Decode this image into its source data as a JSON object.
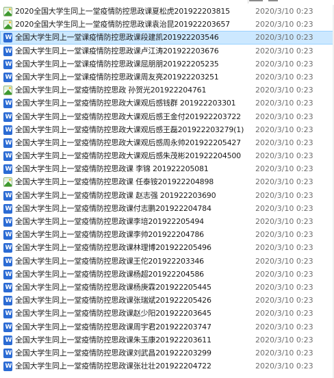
{
  "files": [
    {
      "name": "2020全国大学生同上一堂疫情防控思政课夏松虎201922203815",
      "date": "2020/3/10 0:23",
      "icon": "image-icon"
    },
    {
      "name": "2020全国大学生同上一堂疫情防控思政课袁治昆201922203657",
      "date": "2020/3/10 0:23",
      "icon": "image-icon"
    },
    {
      "name": "全国大学生同上一堂课疫情防控思政课段建凯201922203546",
      "date": "2020/3/10 0:23",
      "icon": "word-icon",
      "selected": true
    },
    {
      "name": "全国大学生同上一堂课疫情防控思政课卢江涛201922203676",
      "date": "2020/3/10 0:23",
      "icon": "word-icon"
    },
    {
      "name": "全国大学生同上一堂课疫情防控思政课屈朋朋201922205235",
      "date": "2020/3/10 0:23",
      "icon": "word-icon"
    },
    {
      "name": "全国大学生同上一堂课疫情防控思政课周友亮201922203251",
      "date": "2020/3/10 0:23",
      "icon": "word-icon"
    },
    {
      "name": "全国大学生同上一堂疫情防控思政 孙贺光201922204761",
      "date": "2020/3/10 0:23",
      "icon": "image-icon"
    },
    {
      "name": "全国大学生同上一堂疫情防控思政大课观后感钱群 201922203301",
      "date": "2020/3/10 0:23",
      "icon": "word-icon"
    },
    {
      "name": "全国大学生同上一堂疫情防控思政大课观后感王金付201922203722",
      "date": "2020/3/10 0:23",
      "icon": "word-icon"
    },
    {
      "name": "全国大学生同上一堂疫情防控思政大课观后感王磊201922203279(1)",
      "date": "2020/3/10 0:23",
      "icon": "word-icon"
    },
    {
      "name": "全国大学生同上一堂疫情防控思政大课观后感周永帅201922205427",
      "date": "2020/3/10 0:23",
      "icon": "word-icon"
    },
    {
      "name": "全国大学生同上一堂疫情防控思政大课观后感朱茂彬201922204500",
      "date": "2020/3/10 0:23",
      "icon": "word-icon"
    },
    {
      "name": "全国大学生同上一堂疫情防控思政课 李锦 201922205081",
      "date": "2020/3/10 0:23",
      "icon": "word-icon"
    },
    {
      "name": "全国大学生同上一堂疫情防控思政课 任泰铵201922204898",
      "date": "2020/3/10 0:23",
      "icon": "image-icon"
    },
    {
      "name": "全国大学生同上一堂疫情防控思政课 赵志强 201922203690",
      "date": "2020/3/10 0:23",
      "icon": "word-icon"
    },
    {
      "name": "全国大学生同上一堂疫情防控思政课付志鹏201922204784",
      "date": "2020/3/10 0:23",
      "icon": "word-icon"
    },
    {
      "name": "全国大学生同上一堂疫情防控思政课李培201922205494",
      "date": "2020/3/10 0:23",
      "icon": "word-icon"
    },
    {
      "name": "全国大学生同上一堂疫情防控思政课李帅201922204786",
      "date": "2020/3/10 0:23",
      "icon": "word-icon"
    },
    {
      "name": "全国大学生同上一堂疫情防控思政课林理博201922205496",
      "date": "2020/3/10 0:23",
      "icon": "word-icon"
    },
    {
      "name": "全国大学生同上一堂疫情防控思政课王佗201922203346",
      "date": "2020/3/10 0:23",
      "icon": "word-icon"
    },
    {
      "name": "全国大学生同上一堂疫情防控思政课杨超201922204586",
      "date": "2020/3/10 0:23",
      "icon": "word-icon"
    },
    {
      "name": "全国大学生同上一堂疫情防控思政课杨庚霖201922205445",
      "date": "2020/3/10 0:23",
      "icon": "word-icon"
    },
    {
      "name": "全国大学生同上一堂疫情防控思政课张瑞斌201922205426",
      "date": "2020/3/10 0:23",
      "icon": "word-icon"
    },
    {
      "name": "全国大学生同上一堂疫情防控思政课赵少阳201922203645",
      "date": "2020/3/10 0:23",
      "icon": "word-icon"
    },
    {
      "name": "全国大学生同上一堂疫情防控思政课周宇君201922203747",
      "date": "2020/3/10 0:23",
      "icon": "word-icon"
    },
    {
      "name": "全国大学生同上一堂疫情防控思政课朱玉康201922203611",
      "date": "2020/3/10 0:23",
      "icon": "word-icon"
    },
    {
      "name": "全国大学生同上一堂疫情防控思政课刘武昌201922203299",
      "date": "2020/3/10 0:23",
      "icon": "word-icon"
    },
    {
      "name": "全国大学生同上一堂疫情防控思政课张壮壮201922204722",
      "date": "2020/3/10 0:23",
      "icon": "word-icon"
    }
  ]
}
